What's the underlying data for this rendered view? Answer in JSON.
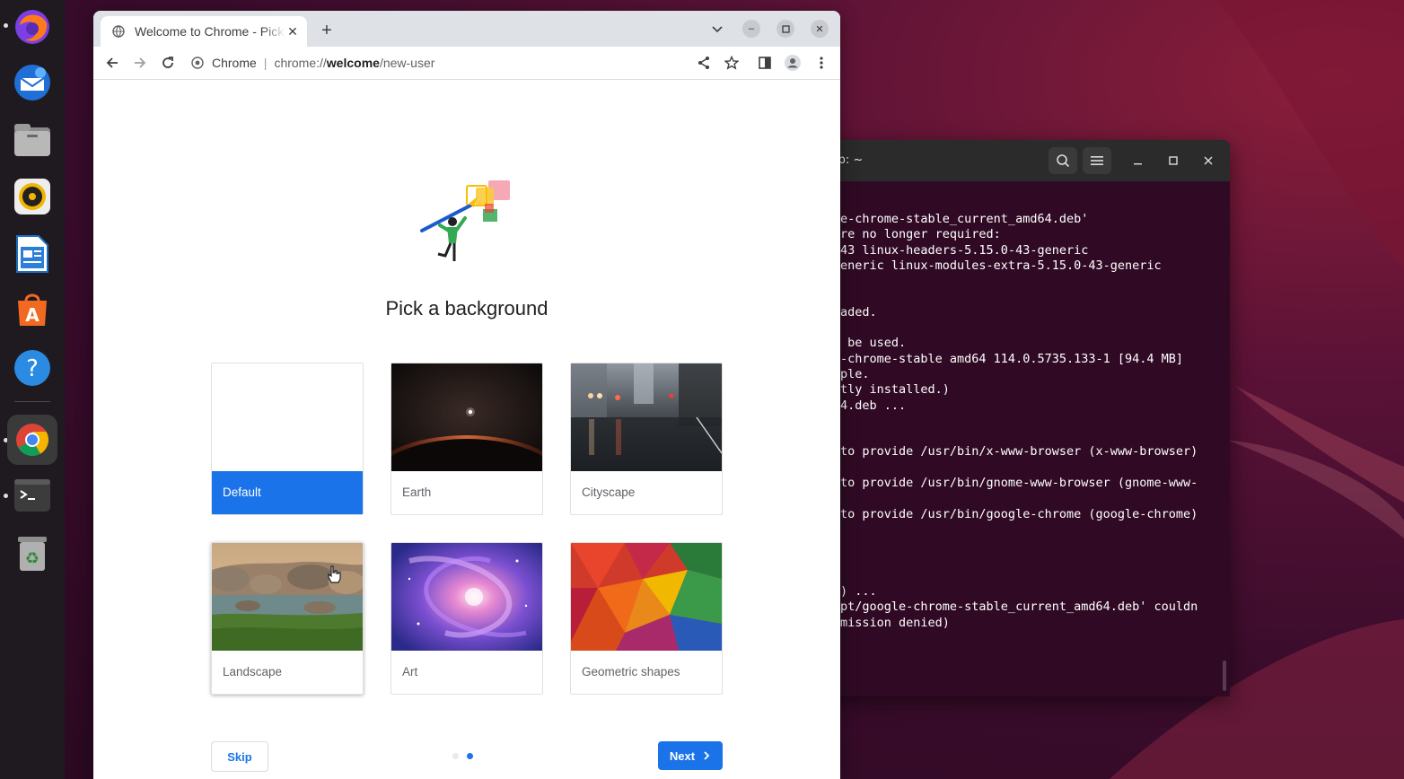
{
  "dock": {
    "items": [
      {
        "name": "firefox-icon"
      },
      {
        "name": "thunderbird-icon"
      },
      {
        "name": "files-icon"
      },
      {
        "name": "rhythmbox-icon"
      },
      {
        "name": "libreoffice-writer-icon"
      },
      {
        "name": "app-center-icon"
      },
      {
        "name": "help-icon"
      },
      {
        "name": "chrome-icon"
      },
      {
        "name": "terminal-icon"
      },
      {
        "name": "trash-icon"
      }
    ]
  },
  "terminal": {
    "title": "lp: ~",
    "lines": [
      "e-chrome-stable_current_amd64.deb'",
      "re no longer required:",
      "43 linux-headers-5.15.0-43-generic",
      "eneric linux-modules-extra-5.15.0-43-generic",
      "",
      "",
      "aded.",
      "",
      " be used.",
      "-chrome-stable amd64 114.0.5735.133-1 [94.4 MB]",
      "ple.",
      "tly installed.)",
      "4.deb ...",
      "",
      "",
      "to provide /usr/bin/x-www-browser (x-www-browser)",
      "",
      "to provide /usr/bin/gnome-www-browser (gnome-www-",
      "",
      "to provide /usr/bin/google-chrome (google-chrome)",
      "",
      "",
      "",
      "",
      ") ...",
      "pt/google-chrome-stable_current_amd64.deb' couldn",
      "mission denied)"
    ]
  },
  "browser": {
    "tab_title": "Welcome to Chrome - Pick a background",
    "omnibox_label": "Chrome",
    "url_scheme": "chrome://",
    "url_host": "welcome",
    "url_path": "/new-user"
  },
  "page": {
    "heading": "Pick a background",
    "cards": [
      {
        "label": "Default",
        "selected": true
      },
      {
        "label": "Earth",
        "selected": false
      },
      {
        "label": "Cityscape",
        "selected": false
      },
      {
        "label": "Landscape",
        "selected": false
      },
      {
        "label": "Art",
        "selected": false
      },
      {
        "label": "Geometric shapes",
        "selected": false
      }
    ],
    "skip_label": "Skip",
    "next_label": "Next",
    "step_current": 2,
    "step_total": 2
  },
  "colors": {
    "accent": "#1a73e8",
    "terminal_bg": "#300a24"
  }
}
